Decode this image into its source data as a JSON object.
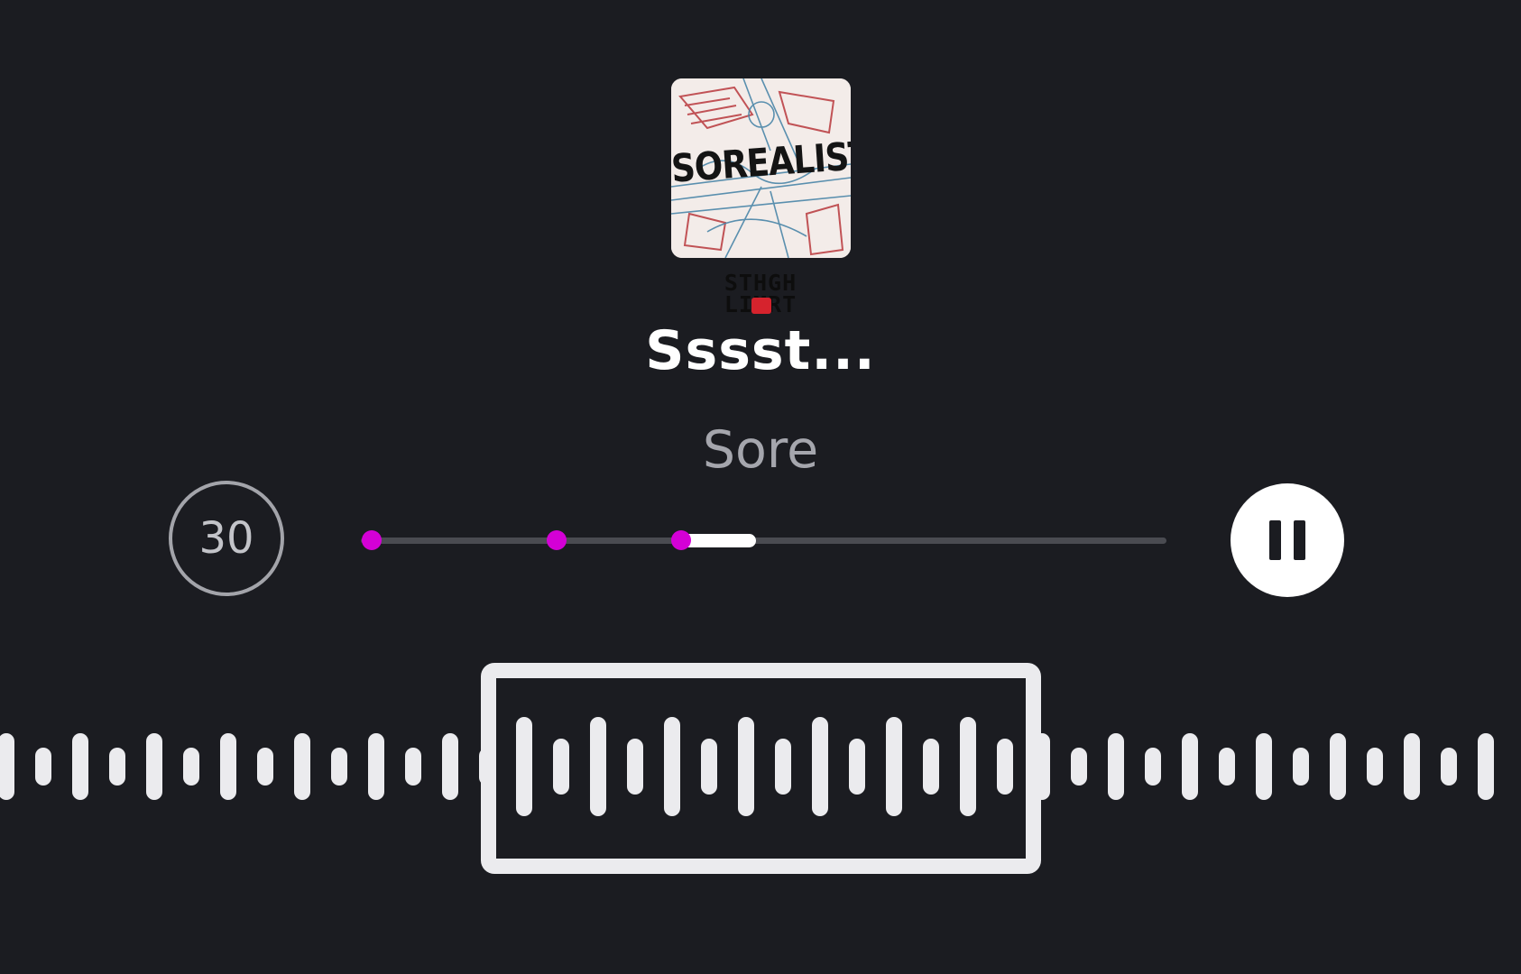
{
  "album": {
    "title": "SOREALIST",
    "palette": {
      "background": "#f3ece9",
      "sketch_red": "#b8383c",
      "sketch_blue": "#4a86a8"
    }
  },
  "sticker": {
    "line1": "STHGH",
    "line2": "LIMRT",
    "accent_color": "#d6232d"
  },
  "track": {
    "title": "Sssst...",
    "artist": "Sore"
  },
  "controls": {
    "skip_label": "30",
    "skip_icon": "skip-30-icon",
    "play_state_icon": "pause-icon"
  },
  "progress": {
    "markers_percent": [
      1.3,
      24.3,
      39.8
    ],
    "played_from_percent": 38.6,
    "played_to_percent": 49.1,
    "marker_color": "#d400d6"
  },
  "waveform": {
    "bar_color": "#ebebee"
  }
}
